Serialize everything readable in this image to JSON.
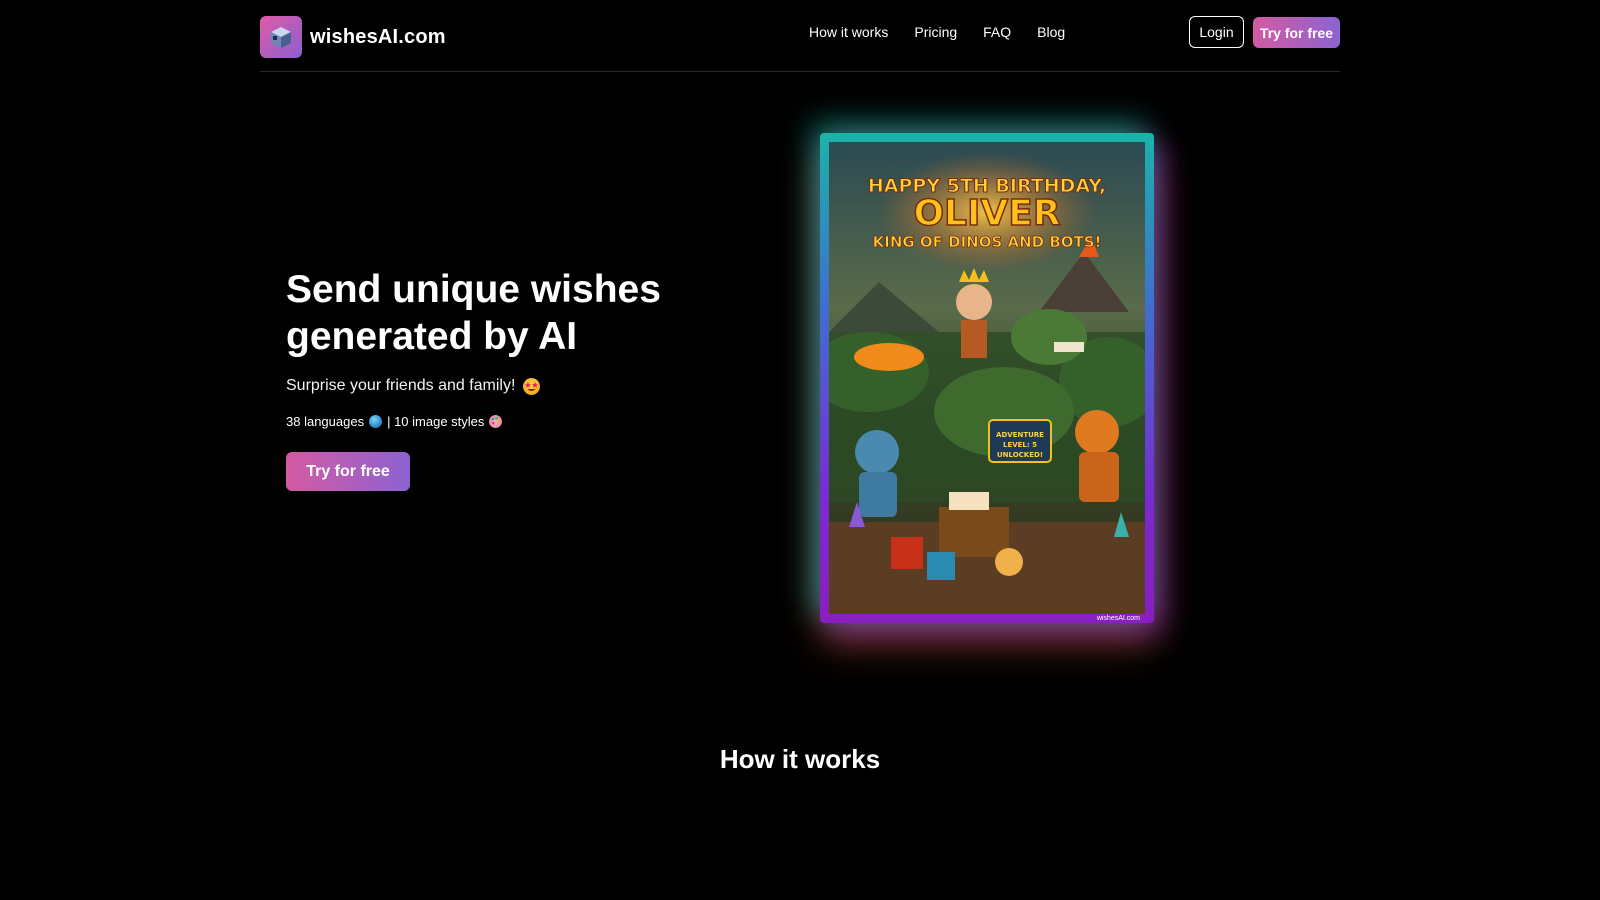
{
  "header": {
    "logo_text": "wishesAI.com",
    "nav": [
      {
        "label": "How it works"
      },
      {
        "label": "Pricing"
      },
      {
        "label": "FAQ"
      },
      {
        "label": "Blog"
      }
    ],
    "login_label": "Login",
    "try_label": "Try for free"
  },
  "hero": {
    "title": "Send unique wishes generated by AI",
    "subtitle": "Surprise your friends and family!",
    "stats_languages": "38 languages",
    "stats_styles": "| 10 image styles",
    "cta_label": "Try for free"
  },
  "card": {
    "line1": "HAPPY 5TH BIRTHDAY,",
    "line2": "OLIVER",
    "line3": "KING OF DINOS AND BOTS!",
    "badge": "ADVENTURE LEVEL: 5 UNLOCKED!",
    "watermark": "wishesAI.com"
  },
  "section": {
    "how_title": "How it works"
  },
  "colors": {
    "background": "#000000",
    "cta_gradient_start": "#d45aa2",
    "cta_gradient_end": "#8c63d1"
  },
  "icons": [
    "cube-logo-icon",
    "star-struck-emoji-icon",
    "globe-emoji-icon",
    "palette-emoji-icon"
  ]
}
